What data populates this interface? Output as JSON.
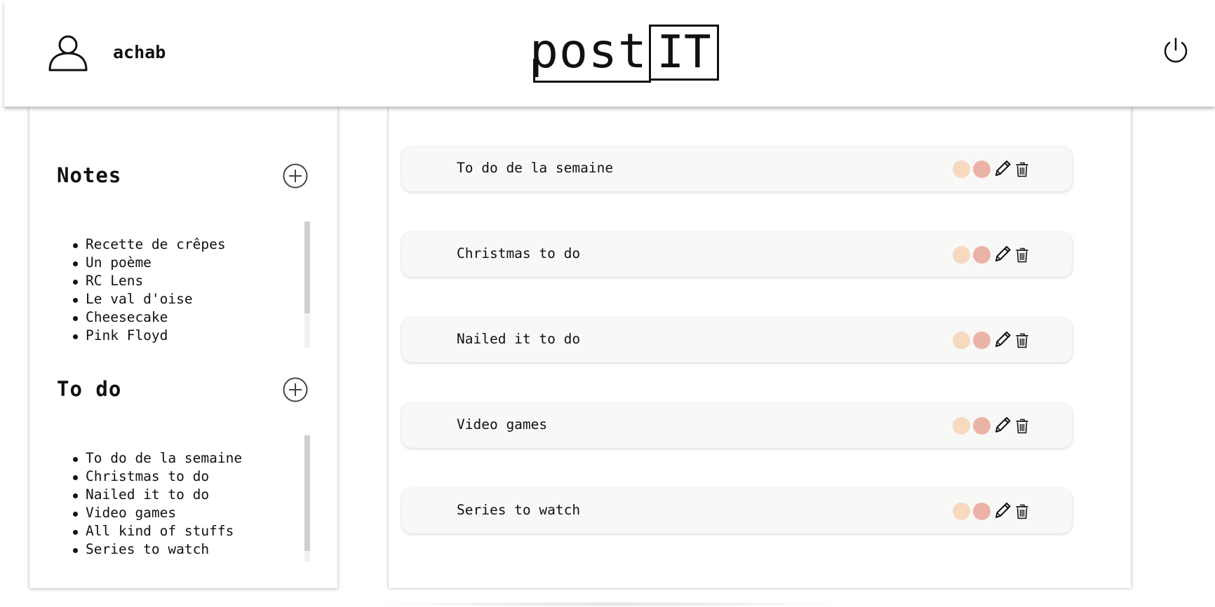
{
  "header": {
    "user_icon": "user-icon",
    "username": "achab",
    "logo": {
      "part1": "post",
      "part2": "IT"
    },
    "logout_icon": "power-icon"
  },
  "sidebar": {
    "notes": {
      "title": "Notes",
      "add_icon": "plus-circle-icon",
      "items": [
        "Recette de crêpes",
        "Un poème",
        "RC Lens",
        "Le val d'oise",
        "Cheesecake",
        "Pink Floyd"
      ]
    },
    "todo": {
      "title": "To do",
      "add_icon": "plus-circle-icon",
      "items": [
        "To do de la semaine",
        "Christmas to do",
        "Nailed it to do",
        "Video games",
        "All kind of stuffs",
        "Series to watch"
      ]
    }
  },
  "main": {
    "cards": [
      {
        "title": "To do de la semaine"
      },
      {
        "title": "Christmas to do"
      },
      {
        "title": "Nailed it to do"
      },
      {
        "title": "Video games"
      },
      {
        "title": "Series to watch"
      }
    ],
    "card_actions": {
      "color_swatches": [
        "#f7d9c0",
        "#ebb3a5"
      ],
      "edit_icon": "pencil-icon",
      "delete_icon": "trash-icon"
    }
  },
  "colors": {
    "background": "#ffffff",
    "card_background": "#f8f8f7",
    "text": "#111111",
    "scroll_thumb": "#cfcfcf",
    "scroll_track": "#f1f1f1"
  }
}
